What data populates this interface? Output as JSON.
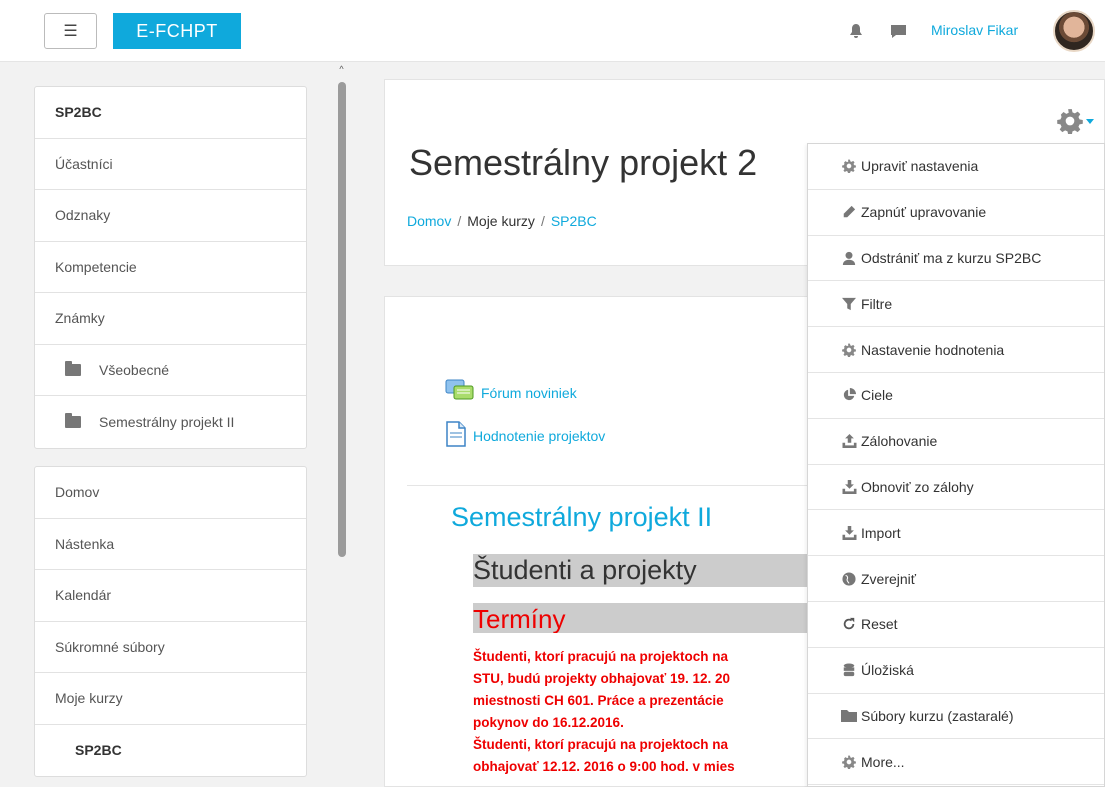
{
  "navbar": {
    "menu_glyph": "☰",
    "brand": "E-FCHPT",
    "user_name": "Miroslav Fikar",
    "icons": [
      "bell-icon",
      "chat-icon"
    ]
  },
  "course_nav": {
    "items": [
      {
        "label": "SP2BC",
        "style": "bold"
      },
      {
        "label": "Účastníci"
      },
      {
        "label": "Odznaky"
      },
      {
        "label": "Kompetencie"
      },
      {
        "label": "Známky"
      },
      {
        "label": "Všeobecné",
        "icon": "folder-icon"
      },
      {
        "label": "Semestrálny projekt II",
        "icon": "folder-icon"
      }
    ]
  },
  "site_nav": {
    "items": [
      {
        "label": "Domov"
      },
      {
        "label": "Nástenka"
      },
      {
        "label": "Kalendár"
      },
      {
        "label": "Súkromné súbory"
      },
      {
        "label": "Moje kurzy"
      },
      {
        "label": "SP2BC",
        "style": "bold"
      }
    ]
  },
  "header": {
    "title": "Semestrálny projekt 2",
    "breadcrumb": [
      {
        "label": "Domov",
        "link": true
      },
      {
        "label": "Moje kurzy",
        "link": false
      },
      {
        "label": "SP2BC",
        "link": true
      }
    ],
    "breadcrumb_sep": "/"
  },
  "activities": [
    {
      "label": "Fórum noviniek",
      "icon": "forum-icon"
    },
    {
      "label": "Hodnotenie projektov",
      "icon": "document-icon"
    }
  ],
  "section": {
    "title": "Semestrálny projekt II",
    "bar1": "Študenti a projekty",
    "bar2": "Termíny",
    "red_lines": [
      "Študenti, ktorí pracujú na projektoch na",
      "STU, budú projekty obhajovať 19. 12. 20",
      "miestnosti CH 601. Práce a prezentácie",
      "pokynov do 16.12.2016.",
      "Študenti, ktorí pracujú na projektoch na",
      "obhajovať 12.12. 2016 o 9:00 hod. v mies"
    ]
  },
  "dropdown": {
    "items": [
      {
        "label": "Upraviť nastavenia",
        "icon": "cog-icon"
      },
      {
        "label": "Zapnúť upravovanie",
        "icon": "pencil-icon"
      },
      {
        "label": "Odstrániť ma z kurzu SP2BC",
        "icon": "user-icon"
      },
      {
        "label": "Filtre",
        "icon": "filter-icon"
      },
      {
        "label": "Nastavenie hodnotenia",
        "icon": "cog-icon"
      },
      {
        "label": "Ciele",
        "icon": "pie-icon"
      },
      {
        "label": "Zálohovanie",
        "icon": "upload-icon"
      },
      {
        "label": "Obnoviť zo zálohy",
        "icon": "download-icon"
      },
      {
        "label": "Import",
        "icon": "download-icon"
      },
      {
        "label": "Zverejniť",
        "icon": "globe-icon"
      },
      {
        "label": "Reset",
        "icon": "refresh-icon"
      },
      {
        "label": "Úložiská",
        "icon": "database-icon"
      },
      {
        "label": "Súbory kurzu (zastaralé)",
        "icon": "folder-icon"
      },
      {
        "label": "More...",
        "icon": "cog-icon"
      }
    ]
  },
  "colors": {
    "accent": "#0fa9dc",
    "alert": "#e00000",
    "bar": "#cccccc"
  }
}
